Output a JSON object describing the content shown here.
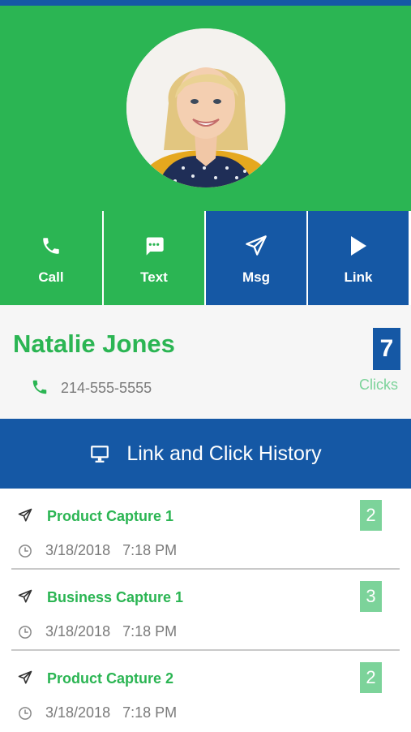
{
  "colors": {
    "green": "#2bb553",
    "blue": "#1558a5",
    "light_green": "#7cd39a",
    "gray_text": "#7a7a7a"
  },
  "profile_photo": {
    "alt": "profile photo",
    "icon": "avatar-photo"
  },
  "actions": [
    {
      "label": "Call",
      "icon": "phone-icon"
    },
    {
      "label": "Text",
      "icon": "chat-bubble-icon"
    },
    {
      "label": "Msg",
      "icon": "paper-plane-icon"
    },
    {
      "label": "Link",
      "icon": "play-icon"
    }
  ],
  "contact": {
    "name": "Natalie Jones",
    "phone": "214-555-5555",
    "clicks_count": "7",
    "clicks_label": "Clicks"
  },
  "history": {
    "title": "Link and Click History",
    "icon": "monitor-icon",
    "items": [
      {
        "title": "Product Capture 1",
        "count": "2",
        "date": "3/18/2018",
        "time": "7:18 PM"
      },
      {
        "title": "Business Capture 1",
        "count": "3",
        "date": "3/18/2018",
        "time": "7:18 PM"
      },
      {
        "title": "Product Capture 2",
        "count": "2",
        "date": "3/18/2018",
        "time": "7:18 PM"
      }
    ]
  }
}
